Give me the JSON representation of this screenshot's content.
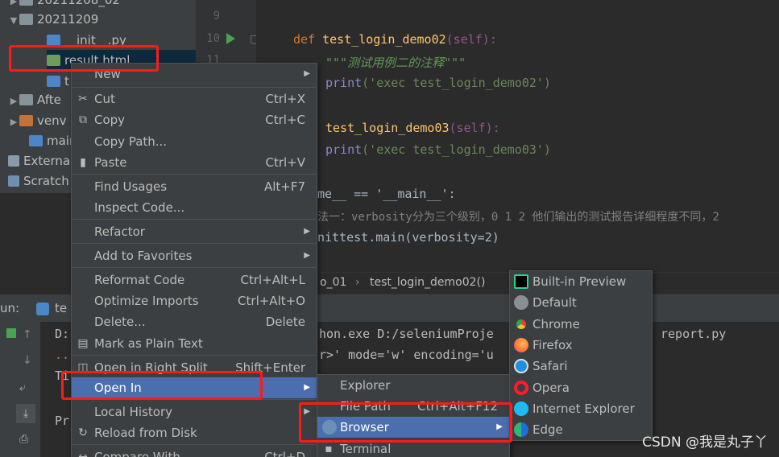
{
  "tree": [
    {
      "label": "20211208_02",
      "arrow": "▶"
    },
    {
      "label": "20211209",
      "arrow": "▼"
    },
    {
      "label": "__init__.py",
      "arrow": ""
    },
    {
      "label": "result.html",
      "arrow": ""
    },
    {
      "label": "t",
      "arrow": ""
    },
    {
      "label": "Afte",
      "arrow": "▶"
    },
    {
      "label": "venv",
      "arrow": "▶"
    },
    {
      "label": "main",
      "arrow": ""
    },
    {
      "label": "External",
      "arrow": ""
    },
    {
      "label": "Scratch",
      "arrow": ""
    }
  ],
  "editor": {
    "line_numbers": [
      "9",
      "10",
      "11"
    ],
    "def1_kw": "def ",
    "def1_name": "test_login_demo02",
    "def1_args": "(self):",
    "doc": "\"\"\"测试用例二的注释\"\"\"",
    "print1_fn": "print",
    "print1_str": "('exec test_login_demo02')",
    "def2_name": "test_login_demo03",
    "print2_str": "('exec test_login_demo03')",
    "main_line": "me__ == '__main__':",
    "comment": "法一：verbosity分为三个级别，0 1 2 他们输出的测试报告详细程度不同，2",
    "unittest_line": "nittest.main(verbosity=2)"
  },
  "breadcrumb": {
    "left": "o_01",
    "sep": "›",
    "right": "test_login_demo02()"
  },
  "run": {
    "label": "un:",
    "tab": "te"
  },
  "console": {
    "line1": "hon.exe D:/seleniumProje",
    "line1b": "report.py",
    "line2": "r>' mode='w' encoding='u",
    "left1": "D:",
    "left2": "..",
    "left3": "Ti",
    "left4": "Pr"
  },
  "context_menu": [
    {
      "label": "New",
      "shortcut": "",
      "sub": true,
      "icon": ""
    },
    {
      "label": "Cut",
      "shortcut": "Ctrl+X",
      "icon": "✂"
    },
    {
      "label": "Copy",
      "shortcut": "Ctrl+C",
      "icon": "⧉"
    },
    {
      "label": "Copy Path...",
      "shortcut": "",
      "icon": ""
    },
    {
      "label": "Paste",
      "shortcut": "Ctrl+V",
      "icon": "📋"
    },
    {
      "label": "Find Usages",
      "shortcut": "Alt+F7",
      "icon": ""
    },
    {
      "label": "Inspect Code...",
      "shortcut": "",
      "icon": ""
    },
    {
      "label": "Refactor",
      "shortcut": "",
      "sub": true,
      "icon": ""
    },
    {
      "label": "Add to Favorites",
      "shortcut": "",
      "sub": true,
      "icon": ""
    },
    {
      "label": "Reformat Code",
      "shortcut": "Ctrl+Alt+L",
      "icon": ""
    },
    {
      "label": "Optimize Imports",
      "shortcut": "Ctrl+Alt+O",
      "icon": ""
    },
    {
      "label": "Delete...",
      "shortcut": "Delete",
      "icon": ""
    },
    {
      "label": "Mark as Plain Text",
      "shortcut": "",
      "icon": "▤"
    },
    {
      "label": "Open in Right Split",
      "shortcut": "Shift+Enter",
      "icon": "◫"
    },
    {
      "label": "Open In",
      "shortcut": "",
      "sub": true,
      "icon": ""
    },
    {
      "label": "Local History",
      "shortcut": "",
      "sub": true,
      "icon": ""
    },
    {
      "label": "Reload from Disk",
      "shortcut": "",
      "icon": "↻"
    },
    {
      "label": "Compare With...",
      "shortcut": "Ctrl+D",
      "icon": "↔"
    }
  ],
  "open_in_menu": [
    {
      "label": "Explorer",
      "shortcut": ""
    },
    {
      "label": "File Path",
      "shortcut": "Ctrl+Alt+F12"
    },
    {
      "label": "Browser",
      "shortcut": "",
      "sub": true
    },
    {
      "label": "Terminal",
      "shortcut": ""
    }
  ],
  "browser_menu": [
    {
      "label": "Built-in Preview",
      "color": "#21d789"
    },
    {
      "label": "Default",
      "color": "#8a8f96"
    },
    {
      "label": "Chrome",
      "color": "#e34133"
    },
    {
      "label": "Firefox",
      "color": "#ff7139"
    },
    {
      "label": "Safari",
      "color": "#1e8fe1"
    },
    {
      "label": "Opera",
      "color": "#ff1b2d"
    },
    {
      "label": "Internet Explorer",
      "color": "#1ebbee"
    },
    {
      "label": "Edge",
      "color": "#2fb47b"
    }
  ],
  "watermark": "CSDN @我是丸子丫"
}
